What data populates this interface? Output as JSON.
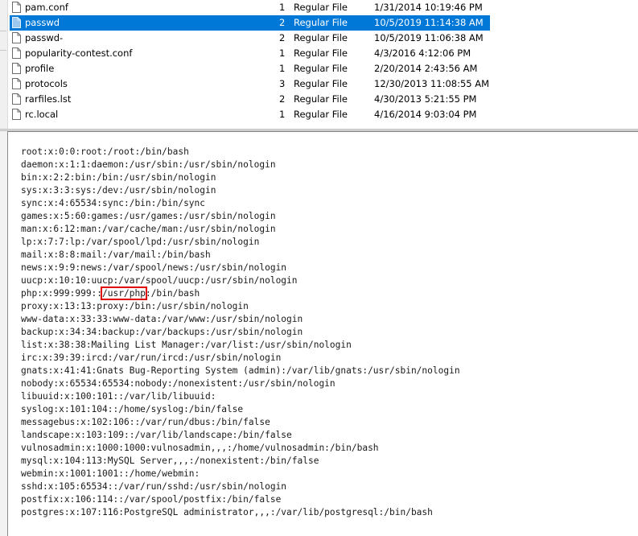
{
  "file_list": {
    "rows": [
      {
        "name": "pam.conf",
        "count": "1",
        "type": "Regular File",
        "date": "1/31/2014 10:19:46 PM",
        "selected": false
      },
      {
        "name": "passwd",
        "count": "2",
        "type": "Regular File",
        "date": "10/5/2019 11:14:38 AM",
        "selected": true
      },
      {
        "name": "passwd-",
        "count": "2",
        "type": "Regular File",
        "date": "10/5/2019 11:06:38 AM",
        "selected": false
      },
      {
        "name": "popularity-contest.conf",
        "count": "1",
        "type": "Regular File",
        "date": "4/3/2016 4:12:06 PM",
        "selected": false
      },
      {
        "name": "profile",
        "count": "1",
        "type": "Regular File",
        "date": "2/20/2014 2:43:56 AM",
        "selected": false
      },
      {
        "name": "protocols",
        "count": "3",
        "type": "Regular File",
        "date": "12/30/2013 11:08:55 AM",
        "selected": false
      },
      {
        "name": "rarfiles.lst",
        "count": "2",
        "type": "Regular File",
        "date": "4/30/2013 5:21:55 PM",
        "selected": false
      },
      {
        "name": "rc.local",
        "count": "1",
        "type": "Regular File",
        "date": "4/16/2014 9:03:04 PM",
        "selected": false
      }
    ],
    "colors": {
      "selection": "#0078d7"
    }
  },
  "viewer": {
    "lines": [
      "root:x:0:0:root:/root:/bin/bash",
      "daemon:x:1:1:daemon:/usr/sbin:/usr/sbin/nologin",
      "bin:x:2:2:bin:/bin:/usr/sbin/nologin",
      "sys:x:3:3:sys:/dev:/usr/sbin/nologin",
      "sync:x:4:65534:sync:/bin:/bin/sync",
      "games:x:5:60:games:/usr/games:/usr/sbin/nologin",
      "man:x:6:12:man:/var/cache/man:/usr/sbin/nologin",
      "lp:x:7:7:lp:/var/spool/lpd:/usr/sbin/nologin",
      "mail:x:8:8:mail:/var/mail:/bin/bash",
      "news:x:9:9:news:/var/spool/news:/usr/sbin/nologin",
      "uucp:x:10:10:uucp:/var/spool/uucp:/usr/sbin/nologin",
      {
        "before": "php:x:999:999::",
        "highlight": "/usr/php",
        "after": ":/bin/bash"
      },
      "proxy:x:13:13:proxy:/bin:/usr/sbin/nologin",
      "www-data:x:33:33:www-data:/var/www:/usr/sbin/nologin",
      "backup:x:34:34:backup:/var/backups:/usr/sbin/nologin",
      "list:x:38:38:Mailing List Manager:/var/list:/usr/sbin/nologin",
      "irc:x:39:39:ircd:/var/run/ircd:/usr/sbin/nologin",
      "gnats:x:41:41:Gnats Bug-Reporting System (admin):/var/lib/gnats:/usr/sbin/nologin",
      "nobody:x:65534:65534:nobody:/nonexistent:/usr/sbin/nologin",
      "libuuid:x:100:101::/var/lib/libuuid:",
      "syslog:x:101:104::/home/syslog:/bin/false",
      "messagebus:x:102:106::/var/run/dbus:/bin/false",
      "landscape:x:103:109::/var/lib/landscape:/bin/false",
      "vulnosadmin:x:1000:1000:vulnosadmin,,,:/home/vulnosadmin:/bin/bash",
      "mysql:x:104:113:MySQL Server,,,:/nonexistent:/bin/false",
      "webmin:x:1001:1001::/home/webmin:",
      "sshd:x:105:65534::/var/run/sshd:/usr/sbin/nologin",
      "postfix:x:106:114::/var/spool/postfix:/bin/false",
      "postgres:x:107:116:PostgreSQL administrator,,,:/var/lib/postgresql:/bin/bash"
    ],
    "colors": {
      "highlight_box": "#e00000"
    }
  }
}
